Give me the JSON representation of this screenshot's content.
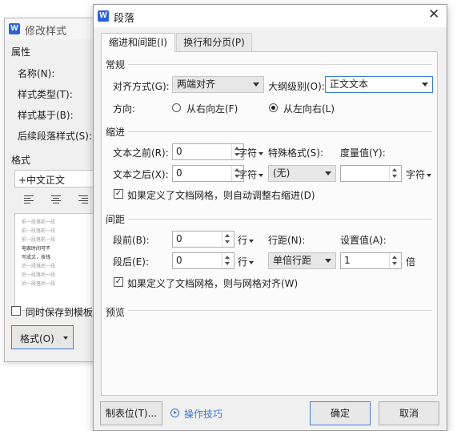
{
  "bg_dialog": {
    "title": "修改样式",
    "section_props": "属性",
    "name_label": "名称(N):",
    "style_type_label": "样式类型(T):",
    "based_on_label": "样式基于(B):",
    "following_label": "后续段落样式(S):",
    "format_section": "格式",
    "font_value": "+中文正文",
    "preview_lines": [
      "前一段落前一段",
      "前一段落前一段",
      "前一段落前一段",
      "电家时间可不",
      "写成文，技钱",
      "后一段落后一段",
      "后一段落后一段",
      "后一段落后一段"
    ],
    "save_to_template": "同时保存到模板",
    "format_button": "格式(O)"
  },
  "dialog": {
    "title": "段落",
    "close_icon": "close-icon",
    "tabs": [
      "缩进和间距(I)",
      "换行和分页(P)"
    ],
    "general": {
      "section": "常规",
      "align_label": "对齐方式(G):",
      "align_value": "两端对齐",
      "outline_label": "大纲级别(O):",
      "outline_value": "正文文本",
      "direction_label": "方向:",
      "rtl_label": "从右向左(F)",
      "ltr_label": "从左向右(L)",
      "direction_selected": "从左向右(L)"
    },
    "indent": {
      "section": "缩进",
      "before_label": "文本之前(R):",
      "before_value": "0",
      "before_unit": "字符",
      "after_label": "文本之后(X):",
      "after_value": "0",
      "after_unit": "字符",
      "special_label": "特殊格式(S):",
      "special_value": "(无)",
      "measure_label": "度量值(Y):",
      "measure_value": "",
      "measure_unit": "字符",
      "auto_adjust_label": "如果定义了文档网格，则自动调整右缩进(D)",
      "auto_adjust_checked": true
    },
    "spacing": {
      "section": "间距",
      "before_label": "段前(B):",
      "before_value": "0",
      "before_unit": "行",
      "after_label": "段后(E):",
      "after_value": "0",
      "after_unit": "行",
      "line_label": "行距(N):",
      "line_value": "单倍行距",
      "setting_label": "设置值(A):",
      "setting_value": "1",
      "setting_unit": "倍",
      "grid_align_label": "如果定义了文档网格，则与网格对齐(W)",
      "grid_align_checked": true
    },
    "preview_section": "预览",
    "tabs_button": "制表位(T)...",
    "tips_link": "操作技巧",
    "ok_button": "确定",
    "cancel_button": "取消"
  },
  "colors": {
    "accent": "#3c7fd8",
    "logo": "#2b63d9",
    "link": "#3b78d8"
  }
}
